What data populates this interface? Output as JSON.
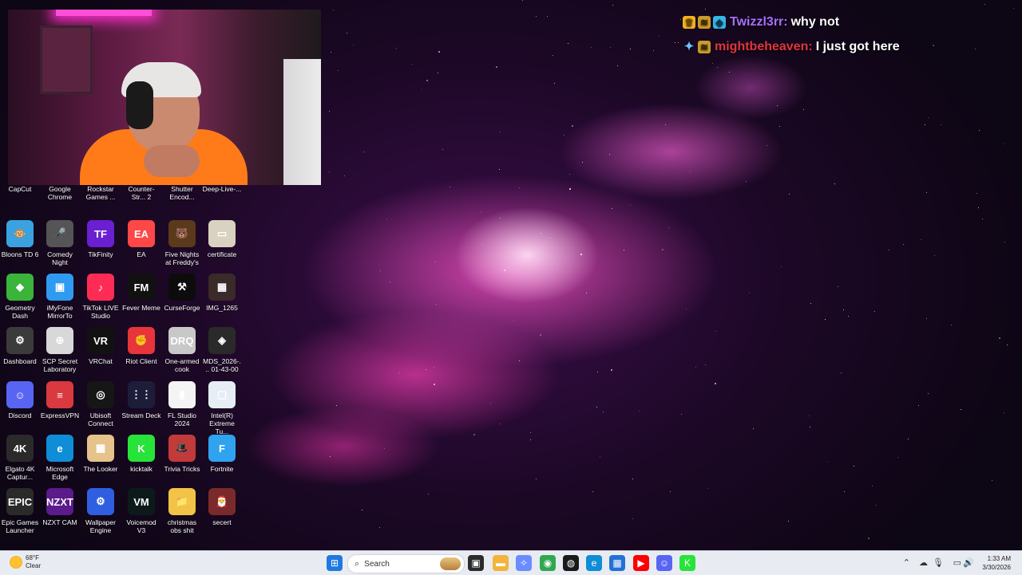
{
  "chat": [
    {
      "badges": [
        "crown",
        "sub",
        "cube"
      ],
      "username": "Twizzl3rr:",
      "username_color": "#a970ff",
      "message": "why not"
    },
    {
      "badges": [
        "pin",
        "sub"
      ],
      "username": "mightbeheaven:",
      "username_color": "#e0363e",
      "message": "I just got here"
    }
  ],
  "desktop_icons": [
    {
      "label": "CapCut",
      "color": "#111111",
      "glyph": "✂"
    },
    {
      "label": "Google Chrome",
      "color": "#e8e8e8",
      "glyph": "◉"
    },
    {
      "label": "Rockstar Games ...",
      "color": "#f2a900",
      "glyph": "R"
    },
    {
      "label": "Counter-Str... 2",
      "color": "#1f2a38",
      "glyph": "CS"
    },
    {
      "label": "Shutter Encod...",
      "color": "#3a3a3a",
      "glyph": "▶"
    },
    {
      "label": "Deep-Live-...",
      "color": "#f2c21a",
      "glyph": "▤"
    },
    {
      "label": "Bloons TD 6",
      "color": "#3aa2e0",
      "glyph": "🐵"
    },
    {
      "label": "Comedy Night",
      "color": "#555555",
      "glyph": "🎤"
    },
    {
      "label": "TikFinity",
      "color": "#6a1fd1",
      "glyph": "TF"
    },
    {
      "label": "EA",
      "color": "#ff4747",
      "glyph": "EA"
    },
    {
      "label": "Five Nights at Freddy's",
      "color": "#5a3a1a",
      "glyph": "🐻"
    },
    {
      "label": "certificate",
      "color": "#d9d2c0",
      "glyph": "▭"
    },
    {
      "label": "Geometry Dash",
      "color": "#3ab43a",
      "glyph": "◆"
    },
    {
      "label": "iMyFone MirrorTo",
      "color": "#2f9bf0",
      "glyph": "▣"
    },
    {
      "label": "TikTok LIVE Studio",
      "color": "#fe2c55",
      "glyph": "♪"
    },
    {
      "label": "Fever Meme",
      "color": "#111111",
      "glyph": "FM"
    },
    {
      "label": "CurseForge",
      "color": "#0c0c0c",
      "glyph": "⚒"
    },
    {
      "label": "IMG_1265",
      "color": "#3a2a2a",
      "glyph": "▦"
    },
    {
      "label": "Dashboard",
      "color": "#3b3b3b",
      "glyph": "⚙"
    },
    {
      "label": "SCP Secret Laboratory",
      "color": "#d8d8d8",
      "glyph": "⊕"
    },
    {
      "label": "VRChat",
      "color": "#111111",
      "glyph": "VR"
    },
    {
      "label": "Riot Client",
      "color": "#e8343b",
      "glyph": "✊"
    },
    {
      "label": "One-armed cook",
      "color": "#c8c8c8",
      "glyph": "DRQ"
    },
    {
      "label": "MDS_2026-... 01-43-00",
      "color": "#2a2a2a",
      "glyph": "◈"
    },
    {
      "label": "Discord",
      "color": "#5865f2",
      "glyph": "☺"
    },
    {
      "label": "ExpressVPN",
      "color": "#da3940",
      "glyph": "≡"
    },
    {
      "label": "Ubisoft Connect",
      "color": "#161616",
      "glyph": "◎"
    },
    {
      "label": "Stream Deck",
      "color": "#1d1d3a",
      "glyph": "⋮⋮"
    },
    {
      "label": "FL Studio 2024",
      "color": "#f4f4f4",
      "glyph": "▮"
    },
    {
      "label": "Intel(R) Extreme Tu...",
      "color": "#e6edf5",
      "glyph": "▢"
    },
    {
      "label": "Elgato 4K Captur...",
      "color": "#2a2a2a",
      "glyph": "4K"
    },
    {
      "label": "Microsoft Edge",
      "color": "#0f8dd6",
      "glyph": "e"
    },
    {
      "label": "The Looker",
      "color": "#e5c38a",
      "glyph": "▦"
    },
    {
      "label": "kicktalk",
      "color": "#27e33a",
      "glyph": "K"
    },
    {
      "label": "Trivia Tricks",
      "color": "#c23a3a",
      "glyph": "🎩"
    },
    {
      "label": "Fortnite",
      "color": "#2fa3f0",
      "glyph": "F"
    },
    {
      "label": "Epic Games Launcher",
      "color": "#2a2a2a",
      "glyph": "EPIC"
    },
    {
      "label": "NZXT CAM",
      "color": "#5b1b8a",
      "glyph": "NZXT"
    },
    {
      "label": "Wallpaper Engine",
      "color": "#2f5fe0",
      "glyph": "⚙"
    },
    {
      "label": "Voicemod V3",
      "color": "#0c1a1a",
      "glyph": "VM"
    },
    {
      "label": "christmas obs shit",
      "color": "#f2c347",
      "glyph": "📁"
    },
    {
      "label": "secert",
      "color": "#7a2a2a",
      "glyph": "🎅"
    }
  ],
  "taskbar": {
    "weather_temp": "68°F",
    "weather_cond": "Clear",
    "search_placeholder": "Search",
    "time": "1:33 AM",
    "date": "3/30/2026",
    "pinned": [
      {
        "name": "start",
        "color": "#1f7ae0",
        "glyph": "⊞"
      },
      {
        "name": "task-view",
        "color": "#2b2b2b",
        "glyph": "▣"
      },
      {
        "name": "file-explorer",
        "color": "#f2b43a",
        "glyph": "▬"
      },
      {
        "name": "copilot",
        "color": "#6b8cff",
        "glyph": "✧"
      },
      {
        "name": "chrome",
        "color": "#2fa84f",
        "glyph": "◉"
      },
      {
        "name": "obs",
        "color": "#1a1a1a",
        "glyph": "◍"
      },
      {
        "name": "edge",
        "color": "#0f8dd6",
        "glyph": "e"
      },
      {
        "name": "store",
        "color": "#2470d6",
        "glyph": "▦"
      },
      {
        "name": "youtube",
        "color": "#ff0000",
        "glyph": "▶"
      },
      {
        "name": "discord",
        "color": "#5865f2",
        "glyph": "☺"
      },
      {
        "name": "kick",
        "color": "#27e33a",
        "glyph": "K"
      }
    ]
  }
}
